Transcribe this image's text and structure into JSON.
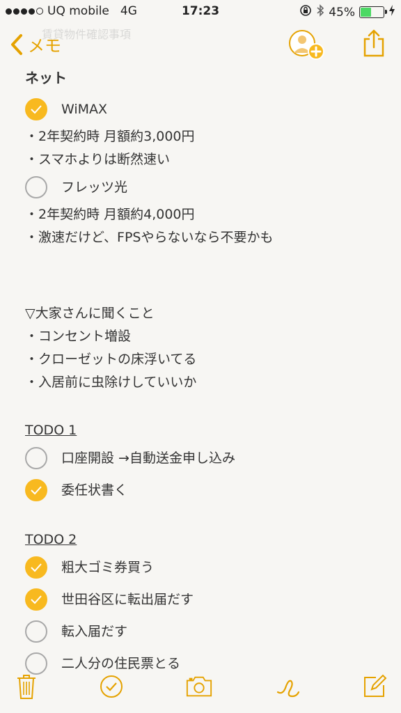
{
  "status_bar": {
    "carrier": "UQ mobile",
    "network": "4G",
    "time": "17:23",
    "battery": "45%",
    "battery_level": 0.45,
    "signal_bars": 4
  },
  "nav": {
    "back_label": "メモ",
    "faded_title": "賃貸物件確認事項",
    "accent_color": "#e5a200"
  },
  "note": {
    "sections": [
      {
        "heading": "ネット",
        "items": [
          {
            "type": "check",
            "checked": true,
            "text": "WiMAX"
          },
          {
            "type": "line",
            "text": "・2年契約時 月額約3,000円"
          },
          {
            "type": "line",
            "text": "・スマホよりは断然速い"
          },
          {
            "type": "check",
            "checked": false,
            "text": "フレッツ光"
          },
          {
            "type": "line",
            "text": "・2年契約時 月額約4,000円"
          },
          {
            "type": "line",
            "text": "・激速だけど、FPSやらないなら不要かも"
          }
        ]
      },
      {
        "lines": [
          "▽大家さんに聞くこと",
          "・コンセント増設",
          "・クローゼットの床浮いてる",
          "・入居前に虫除けしていいか"
        ]
      },
      {
        "title": "TODO 1",
        "items": [
          {
            "checked": false,
            "text": "口座開設 →自動送金申し込み"
          },
          {
            "checked": true,
            "text": "委任状書く"
          }
        ]
      },
      {
        "title": "TODO 2",
        "items": [
          {
            "checked": true,
            "text": "粗大ゴミ券買う"
          },
          {
            "checked": true,
            "text": "世田谷区に転出届だす"
          },
          {
            "checked": false,
            "text": "転入届だす"
          },
          {
            "checked": false,
            "text": "二人分の住民票とる"
          }
        ]
      }
    ]
  },
  "toolbar": {
    "icons": [
      "trash-icon",
      "checklist-icon",
      "camera-icon",
      "sketch-icon",
      "compose-icon"
    ]
  },
  "colors": {
    "check_fill": "#f8b91f",
    "accent": "#e5a200",
    "background": "#f7f6f3"
  }
}
